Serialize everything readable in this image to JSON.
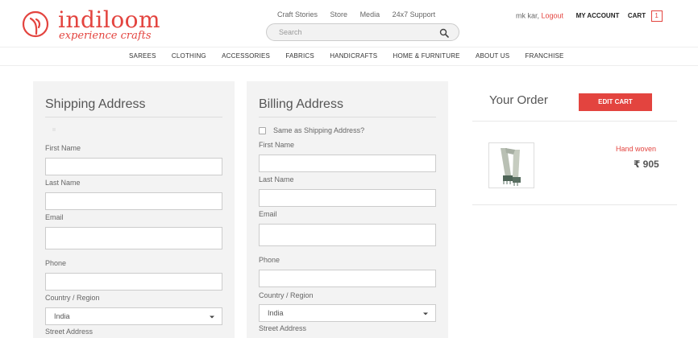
{
  "brand": {
    "name": "indiloom",
    "tagline": "experience crafts",
    "accent": "#e3443f"
  },
  "toplinks": [
    "Craft Stories",
    "Store",
    "Media",
    "24x7 Support"
  ],
  "search": {
    "placeholder": "Search"
  },
  "user": {
    "name": "mk kar,",
    "logout": "Logout",
    "account": "MY ACCOUNT",
    "cart": "CART",
    "cart_count": "1"
  },
  "nav": [
    "SAREES",
    "CLOTHING",
    "ACCESSORIES",
    "FABRICS",
    "HANDICRAFTS",
    "HOME & FURNITURE",
    "ABOUT US",
    "FRANCHISE"
  ],
  "shipping": {
    "title": "Shipping Address",
    "first_name": "First Name",
    "last_name": "Last Name",
    "email": "Email",
    "phone": "Phone",
    "country": "Country / Region",
    "country_value": "India",
    "street": "Street Address"
  },
  "billing": {
    "title": "Billing Address",
    "same_as": "Same as Shipping Address?",
    "first_name": "First Name",
    "last_name": "Last Name",
    "email": "Email",
    "phone": "Phone",
    "country": "Country / Region",
    "country_value": "India",
    "street": "Street Address"
  },
  "order": {
    "title": "Your Order",
    "edit_cart": "EDIT CART",
    "item_name": "Hand woven",
    "item_price": "₹ 905"
  }
}
